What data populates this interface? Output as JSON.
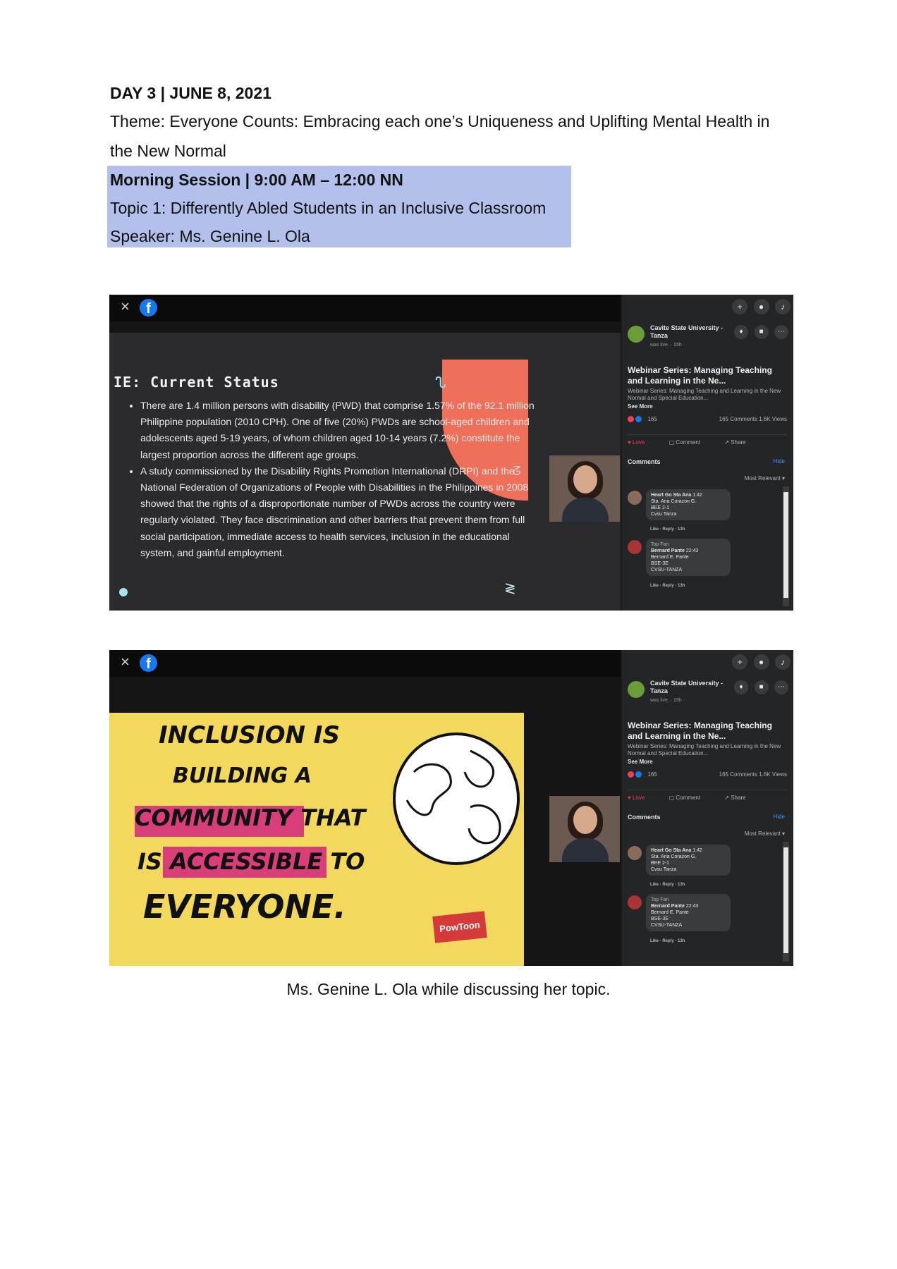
{
  "doc": {
    "day_line": "DAY 3 | JUNE 8, 2021",
    "theme_line1": "Theme: Everyone Counts: Embracing each one’s Uniqueness and Uplifting Mental Health in",
    "theme_line2": "the New Normal",
    "session_title": "Morning Session | 9:00 AM – 12:00 NN",
    "topic": "Topic 1: Differently Abled Students in an Inclusive Classroom",
    "speaker": "Speaker: Ms. Genine L. Ola",
    "caption": "Ms. Genine L. Ola while discussing her topic."
  },
  "window": {
    "close_glyph": "×",
    "logo_glyph": "f",
    "colors": {
      "facebook_blue": "#1877f2",
      "highlight": "#b4c0ec",
      "coral": "#ee6f5a",
      "slide_yellow": "#f3d85e",
      "slide_pink": "#d83f7a"
    }
  },
  "slide1": {
    "heading": "IE: Current Status",
    "bullets": [
      "There are 1.4 million persons with disability (PWD) that comprise 1.57% of the 92.1 million Philippine population (2010 CPH). One of five (20%) PWDs are school-aged children and adolescents aged 5-19 years, of whom children aged 10-14 years (7.2%) constitute the largest proportion across the different age groups.",
      "A study commissioned by the Disability Rights Promotion International (DRPI) and the National Federation of Organizations of People with Disabilities in the Philippines in 2008 showed that the rights of a disproportionate number of PWDs across the country were regularly violated. They face discrimination and other barriers that prevent them from full social participation, immediate access to health services, inclusion in the educational system, and gainful employment."
    ]
  },
  "slide2": {
    "line1": "INCLUSION IS",
    "line2": "BUILDING A",
    "line3": "COMMUNITY THAT",
    "line4": "IS ACCESSIBLE TO",
    "line5": "EVERYONE.",
    "brand": "PowToon"
  },
  "panel": {
    "page_name": "Cavite State University - Tanza",
    "page_meta": "was live. · 15h ·",
    "video_title": "Webinar Series: Managing Teaching and Learning in the Ne...",
    "video_desc": "Webinar Series: Managing Teaching and Learning in the New Normal and Special Education...",
    "see_more": "See More",
    "reaction_count": "165",
    "stats": "165 Comments  1.6K Views",
    "love_label": "Love",
    "comment_label": "Comment",
    "share_label": "Share",
    "comments_heading": "Comments",
    "hide_label": "Hide",
    "sort_label": "Most Relevant ▾",
    "comments": [
      {
        "author": "Heart Go Sta Ana",
        "time": "1:42",
        "lines": [
          "Sta. Ana Corazon G.",
          "BEE 2-1",
          "Cvsu Tanza"
        ],
        "actions": "Like · Reply · 13h"
      },
      {
        "badge": "Top Fan",
        "author": "Bernard Pante",
        "time": "22:43",
        "lines": [
          "Bernard E. Pante",
          "BSE-3E",
          "CVSU-TANZA"
        ],
        "actions": "Like · Reply · 13h"
      }
    ]
  }
}
